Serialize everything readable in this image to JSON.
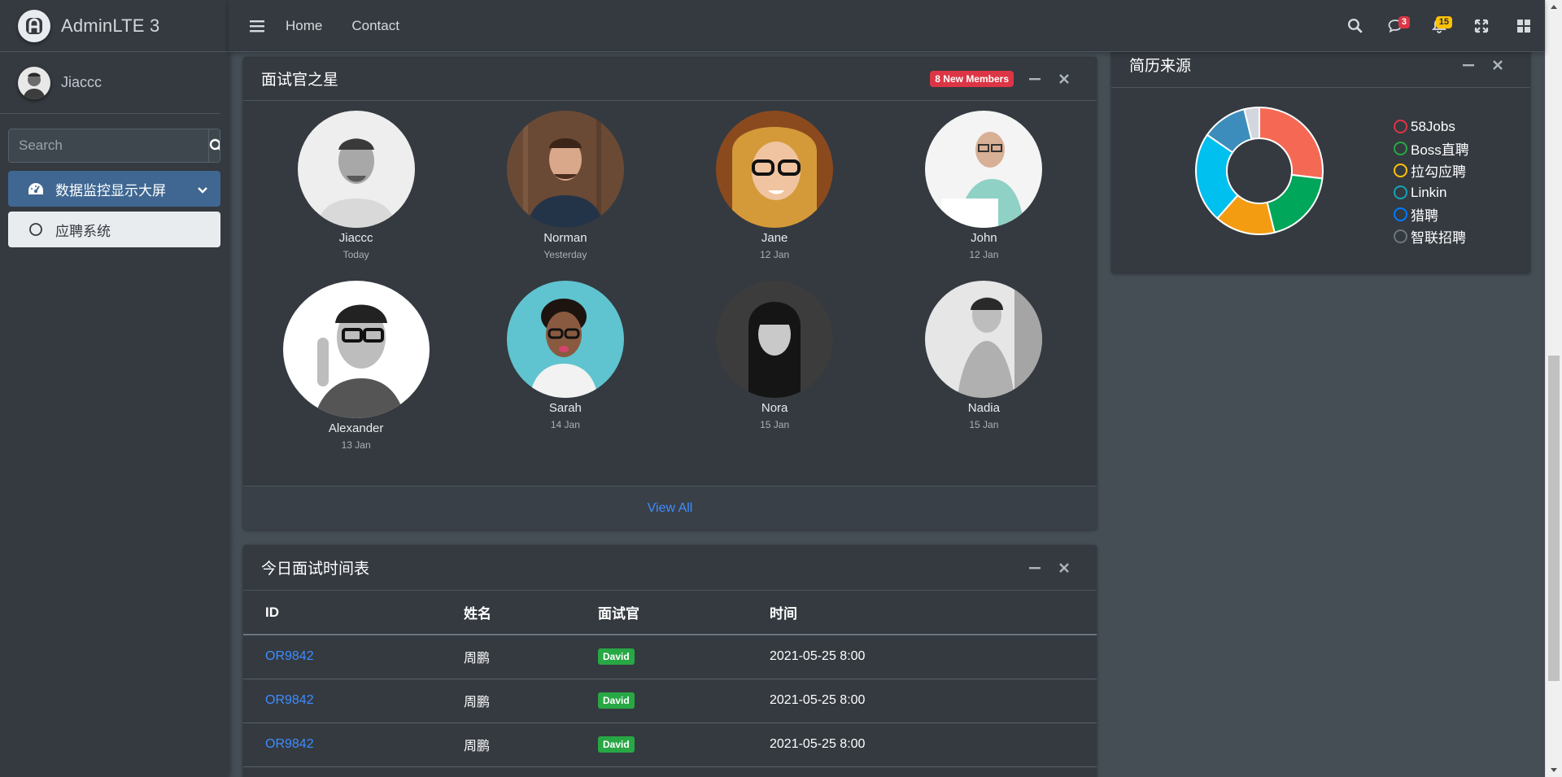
{
  "brand": {
    "title": "AdminLTE 3",
    "logo": "adminlte-logo"
  },
  "user": {
    "name": "Jiaccc",
    "avatar": "user-avatar-photo"
  },
  "search": {
    "placeholder": "Search"
  },
  "sidebar": {
    "items": [
      {
        "label": "数据监控显示大屏",
        "icon": "dashboard-gauge-icon",
        "active": true
      },
      {
        "label": "应聘系统",
        "icon": "circle-outline-icon"
      }
    ]
  },
  "topnav": {
    "links": [
      "Home",
      "Contact"
    ],
    "messages_count": "3",
    "notifications_count": "15"
  },
  "members_card": {
    "title": "面试官之星",
    "badge": "8 New Members",
    "footer_link": "View All",
    "members": [
      {
        "name": "Jiaccc",
        "date": "Today"
      },
      {
        "name": "Norman",
        "date": "Yesterday"
      },
      {
        "name": "Jane",
        "date": "12 Jan"
      },
      {
        "name": "John",
        "date": "12 Jan"
      },
      {
        "name": "Alexander",
        "date": "13 Jan"
      },
      {
        "name": "Sarah",
        "date": "14 Jan"
      },
      {
        "name": "Nora",
        "date": "15 Jan"
      },
      {
        "name": "Nadia",
        "date": "15 Jan"
      }
    ]
  },
  "schedule_card": {
    "title": "今日面试时间表",
    "columns": [
      "ID",
      "姓名",
      "面试官",
      "时间"
    ],
    "rows": [
      {
        "id": "OR9842",
        "name": "周鹏",
        "interviewer": "David",
        "time": "2021-05-25 8:00"
      },
      {
        "id": "OR9842",
        "name": "周鹏",
        "interviewer": "David",
        "time": "2021-05-25 8:00"
      },
      {
        "id": "OR9842",
        "name": "周鹏",
        "interviewer": "David",
        "time": "2021-05-25 8:00"
      }
    ]
  },
  "source_card": {
    "title": "简历来源"
  },
  "chart_data": {
    "type": "pie",
    "title": "简历来源",
    "categories": [
      "58Jobs",
      "Boss直聘",
      "拉勾应聘",
      "Linkin",
      "猎聘",
      "智联招聘"
    ],
    "values": [
      700,
      500,
      400,
      600,
      300,
      100
    ],
    "colors": [
      "#f56954",
      "#00a65a",
      "#f39c12",
      "#00c0ef",
      "#3c8dbc",
      "#d2d6de"
    ],
    "legend_position": "right",
    "donut": true
  }
}
